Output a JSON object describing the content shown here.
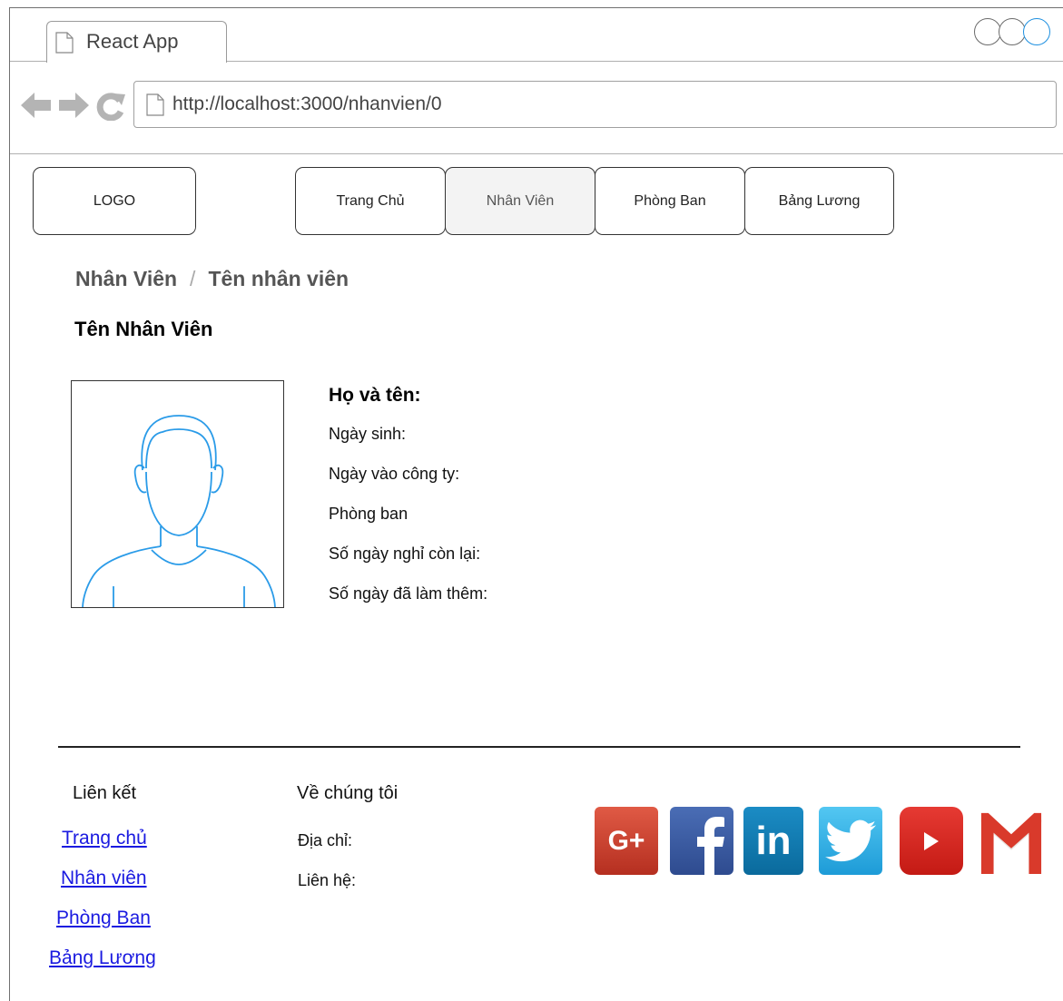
{
  "browser": {
    "tab_title": "React App",
    "url": "http://localhost:3000/nhanvien/0"
  },
  "header": {
    "logo": "LOGO",
    "menu": [
      {
        "label": "Trang Chủ"
      },
      {
        "label": "Nhân Viên",
        "active": true
      },
      {
        "label": "Phòng Ban"
      },
      {
        "label": "Bảng Lương"
      }
    ]
  },
  "breadcrumb": {
    "parent": "Nhân Viên",
    "separator": "/",
    "current": "Tên nhân viên"
  },
  "page_title": "Tên Nhân Viên",
  "employee": {
    "name_label": "Họ và tên:",
    "fields": [
      "Ngày sinh:",
      "Ngày vào công ty:",
      "Phòng ban",
      "Số ngày nghỉ còn lại:",
      "Số ngày đã làm thêm:"
    ]
  },
  "footer": {
    "links_heading": "Liên kết",
    "links": [
      "Trang chủ",
      "Nhân viên",
      "Phòng Ban",
      "Bảng Lương"
    ],
    "about_heading": "Về chúng tôi",
    "address_label": "Địa chỉ:",
    "contact_label": "Liên hệ:",
    "social_icons": [
      "google-plus-icon",
      "facebook-icon",
      "linkedin-icon",
      "twitter-icon",
      "youtube-icon",
      "gmail-icon"
    ],
    "social_text": {
      "gplus": "G+",
      "linkedin": "in"
    }
  },
  "colors": {
    "link": "#1a1ae0",
    "avatar_stroke": "#2a9be8",
    "active_menu_bg": "#f3f3f3"
  }
}
